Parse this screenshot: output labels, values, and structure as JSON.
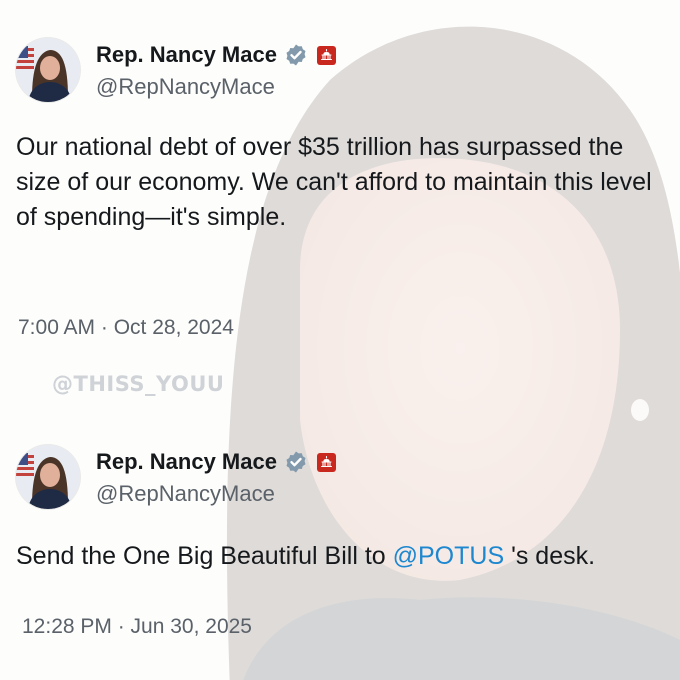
{
  "background": {
    "description_icon": "portrait-photo"
  },
  "watermark": {
    "text": "@THISS_YOUU"
  },
  "tweets": [
    {
      "author_name": "Rep. Nancy Mace",
      "handle": "@RepNancyMace",
      "verified_icon": "verified-badge-icon",
      "gov_icon": "capitol-badge-icon",
      "text": "Our national debt of over $35 trillion has surpassed the size of our economy. We can't afford to maintain this level of spending—it's simple.",
      "timestamp": "7:00 AM · Oct 28, 2024"
    },
    {
      "author_name": "Rep. Nancy Mace",
      "handle": "@RepNancyMace",
      "verified_icon": "verified-badge-icon",
      "gov_icon": "capitol-badge-icon",
      "text_before": "Send the One Big Beautiful Bill to ",
      "mention": "@POTUS",
      "text_after": " 's desk.",
      "timestamp": "12:28 PM · Jun 30, 2025"
    }
  ],
  "colors": {
    "text": "#16191c",
    "muted": "#5a6168",
    "link": "#1d87d0",
    "verified": "#829aab",
    "gov_badge": "#c8281e"
  }
}
